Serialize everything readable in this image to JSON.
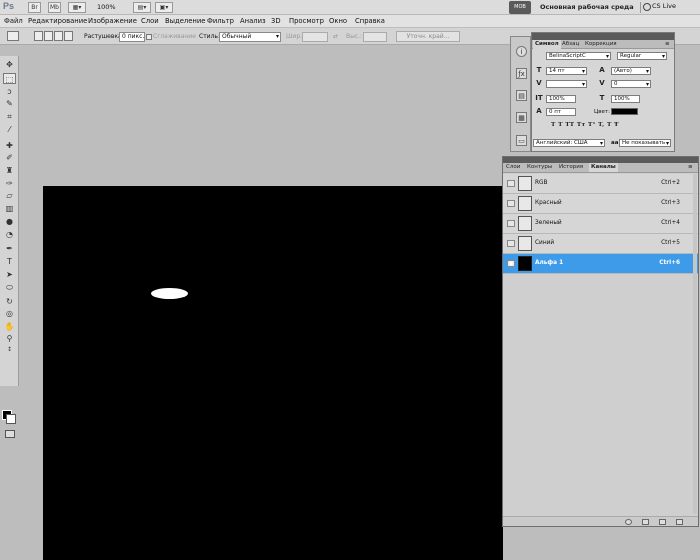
{
  "titlebar": {
    "app": "Ps",
    "zoom": "100%",
    "workspace_button": "MOB",
    "workspace": "Основная рабочая среда",
    "cs_live": "CS Live"
  },
  "menu": [
    "Файл",
    "Редактирование",
    "Изображение",
    "Слои",
    "Выделение",
    "Фильтр",
    "Анализ",
    "3D",
    "Просмотр",
    "Окно",
    "Справка"
  ],
  "options": {
    "feather_label": "Растушевка:",
    "feather_value": "0 пикс.",
    "antialias_label": "Сглаживание",
    "style_label": "Стиль:",
    "style_value": "Обычный",
    "width_label": "Шир.:",
    "height_label": "Выс.:",
    "refine_button": "Уточн. край..."
  },
  "character": {
    "tabs": [
      "Символ",
      "Абзац",
      "Коррекция"
    ],
    "font_family": "BelinaScriptC",
    "font_style": "Regular",
    "size": "14 пт",
    "leading": "(Авто)",
    "tracking": "0",
    "vscale": "100%",
    "hscale": "100%",
    "baseline": "0 пт",
    "color_label": "Цвет:",
    "color_value": "#000000",
    "typo_buttons": "T  T  TT  Tт  T¹  T,  T  Ŧ",
    "language": "Английский: США",
    "antialias": "Не показывать",
    "aa_icon": "aa"
  },
  "channels": {
    "tabs": [
      "Слои",
      "Контуры",
      "История",
      "Каналы"
    ],
    "active_tab": "Каналы",
    "rows": [
      {
        "name": "RGB",
        "shortcut": "Ctrl+2"
      },
      {
        "name": "Красный",
        "shortcut": "Ctrl+3"
      },
      {
        "name": "Зеленый",
        "shortcut": "Ctrl+4"
      },
      {
        "name": "Синий",
        "shortcut": "Ctrl+5"
      },
      {
        "name": "Альфа 1",
        "shortcut": "Ctrl+6"
      }
    ],
    "selected": "Альфа 1"
  },
  "colors": {
    "selected_row": "#3d9be9",
    "canvas": "#000000",
    "workspace_bg": "#bdbdbd"
  }
}
